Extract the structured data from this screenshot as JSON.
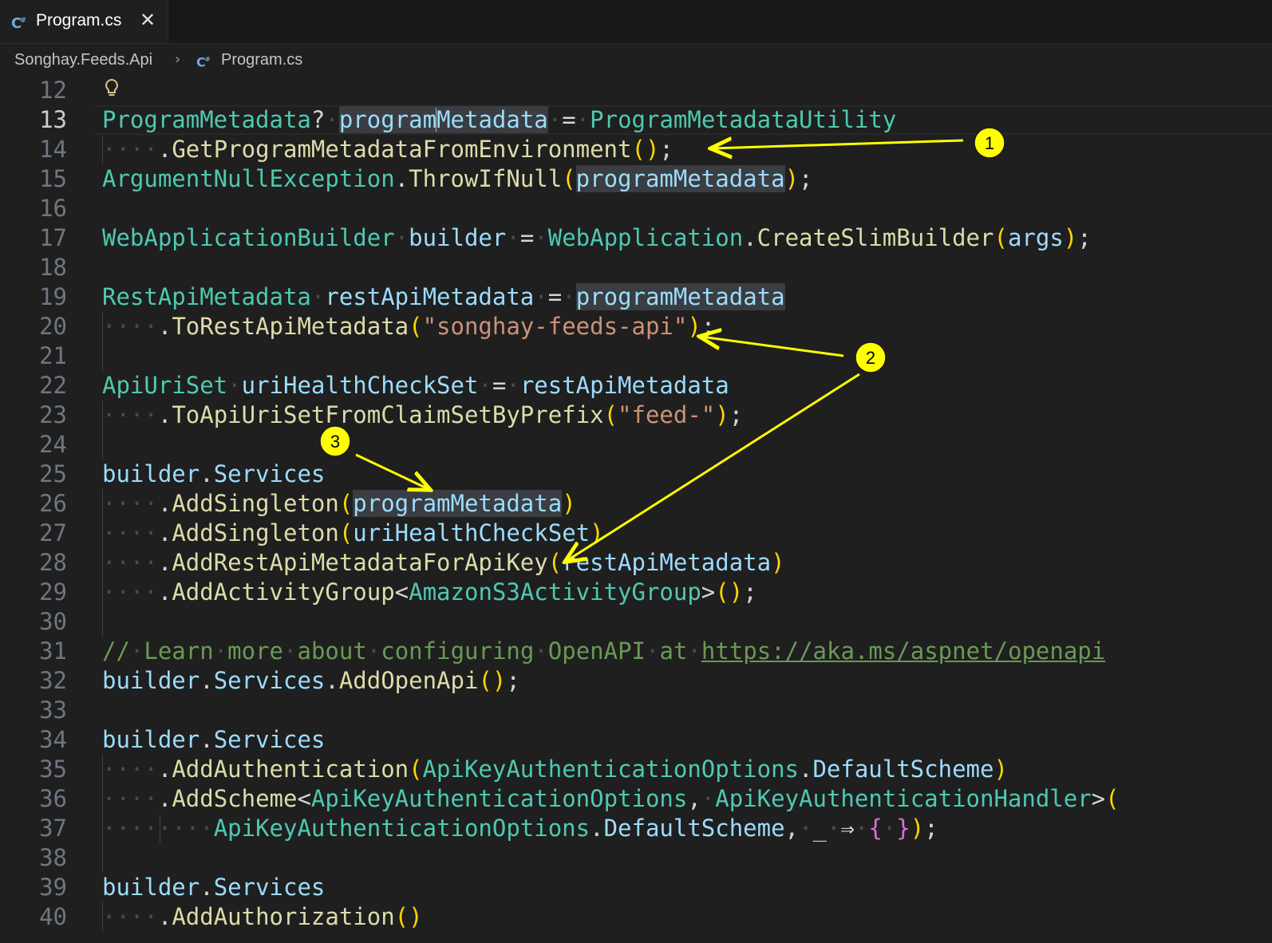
{
  "tab": {
    "label": "Program.cs",
    "icon": "csharp-file-icon",
    "close": "close-icon"
  },
  "breadcrumb": {
    "project": "Songhay.Feeds.Api",
    "file": "Program.cs"
  },
  "editor": {
    "active_line": 13,
    "lines": [
      {
        "n": "12"
      },
      {
        "n": "13"
      },
      {
        "n": "14"
      },
      {
        "n": "15"
      },
      {
        "n": "16"
      },
      {
        "n": "17"
      },
      {
        "n": "18"
      },
      {
        "n": "19"
      },
      {
        "n": "20"
      },
      {
        "n": "21"
      },
      {
        "n": "22"
      },
      {
        "n": "23"
      },
      {
        "n": "24"
      },
      {
        "n": "25"
      },
      {
        "n": "26"
      },
      {
        "n": "27"
      },
      {
        "n": "28"
      },
      {
        "n": "29"
      },
      {
        "n": "30"
      },
      {
        "n": "31"
      },
      {
        "n": "32"
      },
      {
        "n": "33"
      },
      {
        "n": "34"
      },
      {
        "n": "35"
      },
      {
        "n": "36"
      },
      {
        "n": "37"
      },
      {
        "n": "38"
      },
      {
        "n": "39"
      },
      {
        "n": "40"
      }
    ],
    "code": [
      [],
      [
        [
          "t",
          "ProgramMetadata"
        ],
        [
          "p",
          "?"
        ],
        [
          "ws",
          "·"
        ],
        [
          "v hl",
          "program"
        ],
        [
          "cursor",
          ""
        ],
        [
          "v hl",
          "Metadata"
        ],
        [
          "ws",
          "·"
        ],
        [
          "p",
          "="
        ],
        [
          "ws",
          "·"
        ],
        [
          "t",
          "ProgramMetadataUtility"
        ]
      ],
      [
        [
          "ws",
          "····"
        ],
        [
          "p",
          "."
        ],
        [
          "m",
          "GetProgramMetadataFromEnvironment"
        ],
        [
          "b1",
          "()"
        ],
        [
          "p",
          ";"
        ]
      ],
      [
        [
          "t",
          "ArgumentNullException"
        ],
        [
          "p",
          "."
        ],
        [
          "m",
          "ThrowIfNull"
        ],
        [
          "b1",
          "("
        ],
        [
          "v hl",
          "programMetadata"
        ],
        [
          "b1",
          ")"
        ],
        [
          "p",
          ";"
        ]
      ],
      [],
      [
        [
          "t",
          "WebApplicationBuilder"
        ],
        [
          "ws",
          "·"
        ],
        [
          "v",
          "builder"
        ],
        [
          "ws",
          "·"
        ],
        [
          "p",
          "="
        ],
        [
          "ws",
          "·"
        ],
        [
          "t",
          "WebApplication"
        ],
        [
          "p",
          "."
        ],
        [
          "m",
          "CreateSlimBuilder"
        ],
        [
          "b1",
          "("
        ],
        [
          "v",
          "args"
        ],
        [
          "b1",
          ")"
        ],
        [
          "p",
          ";"
        ]
      ],
      [],
      [
        [
          "t",
          "RestApiMetadata"
        ],
        [
          "ws",
          "·"
        ],
        [
          "v",
          "restApiMetadata"
        ],
        [
          "ws",
          "·"
        ],
        [
          "p",
          "="
        ],
        [
          "ws",
          "·"
        ],
        [
          "v hl",
          "programMetadata"
        ]
      ],
      [
        [
          "ws",
          "····"
        ],
        [
          "p",
          "."
        ],
        [
          "m",
          "ToRestApiMetadata"
        ],
        [
          "b1",
          "("
        ],
        [
          "s",
          "\"songhay-feeds-api\""
        ],
        [
          "b1",
          ")"
        ],
        [
          "p",
          ";"
        ]
      ],
      [],
      [
        [
          "t",
          "ApiUriSet"
        ],
        [
          "ws",
          "·"
        ],
        [
          "v",
          "uriHealthCheckSet"
        ],
        [
          "ws",
          "·"
        ],
        [
          "p",
          "="
        ],
        [
          "ws",
          "·"
        ],
        [
          "v",
          "restApiMetadata"
        ]
      ],
      [
        [
          "ws",
          "····"
        ],
        [
          "p",
          "."
        ],
        [
          "m",
          "ToApiUriSetFromClaimSetByPrefix"
        ],
        [
          "b1",
          "("
        ],
        [
          "s",
          "\"feed-\""
        ],
        [
          "b1",
          ")"
        ],
        [
          "p",
          ";"
        ]
      ],
      [],
      [
        [
          "v",
          "builder"
        ],
        [
          "p",
          "."
        ],
        [
          "v",
          "Services"
        ]
      ],
      [
        [
          "ws",
          "····"
        ],
        [
          "p",
          "."
        ],
        [
          "m",
          "AddSingleton"
        ],
        [
          "b1",
          "("
        ],
        [
          "v hl",
          "programMetadata"
        ],
        [
          "b1",
          ")"
        ]
      ],
      [
        [
          "ws",
          "····"
        ],
        [
          "p",
          "."
        ],
        [
          "m",
          "AddSingleton"
        ],
        [
          "b1",
          "("
        ],
        [
          "v",
          "uriHealthCheckSet"
        ],
        [
          "b1",
          ")"
        ]
      ],
      [
        [
          "ws",
          "····"
        ],
        [
          "p",
          "."
        ],
        [
          "m",
          "AddRestApiMetadataForApiKey"
        ],
        [
          "b1",
          "("
        ],
        [
          "v",
          "restApiMetadata"
        ],
        [
          "b1",
          ")"
        ]
      ],
      [
        [
          "ws",
          "····"
        ],
        [
          "p",
          "."
        ],
        [
          "m",
          "AddActivityGroup"
        ],
        [
          "p",
          "<"
        ],
        [
          "t",
          "AmazonS3ActivityGroup"
        ],
        [
          "p",
          ">"
        ],
        [
          "b1",
          "()"
        ],
        [
          "p",
          ";"
        ]
      ],
      [],
      [
        [
          "c",
          "//"
        ],
        [
          "ws",
          "·"
        ],
        [
          "c",
          "Learn"
        ],
        [
          "ws",
          "·"
        ],
        [
          "c",
          "more"
        ],
        [
          "ws",
          "·"
        ],
        [
          "c",
          "about"
        ],
        [
          "ws",
          "·"
        ],
        [
          "c",
          "configuring"
        ],
        [
          "ws",
          "·"
        ],
        [
          "c",
          "OpenAPI"
        ],
        [
          "ws",
          "·"
        ],
        [
          "c",
          "at"
        ],
        [
          "ws",
          "·"
        ],
        [
          "u",
          "https://aka.ms/aspnet/openapi"
        ]
      ],
      [
        [
          "v",
          "builder"
        ],
        [
          "p",
          "."
        ],
        [
          "v",
          "Services"
        ],
        [
          "p",
          "."
        ],
        [
          "m",
          "AddOpenApi"
        ],
        [
          "b1",
          "()"
        ],
        [
          "p",
          ";"
        ]
      ],
      [],
      [
        [
          "v",
          "builder"
        ],
        [
          "p",
          "."
        ],
        [
          "v",
          "Services"
        ]
      ],
      [
        [
          "ws",
          "····"
        ],
        [
          "p",
          "."
        ],
        [
          "m",
          "AddAuthentication"
        ],
        [
          "b1",
          "("
        ],
        [
          "t",
          "ApiKeyAuthenticationOptions"
        ],
        [
          "p",
          "."
        ],
        [
          "v",
          "DefaultScheme"
        ],
        [
          "b1",
          ")"
        ]
      ],
      [
        [
          "ws",
          "····"
        ],
        [
          "p",
          "."
        ],
        [
          "m",
          "AddScheme"
        ],
        [
          "p",
          "<"
        ],
        [
          "t",
          "ApiKeyAuthenticationOptions"
        ],
        [
          "p",
          ","
        ],
        [
          "ws",
          "·"
        ],
        [
          "t",
          "ApiKeyAuthenticationHandler"
        ],
        [
          "p",
          ">"
        ],
        [
          "b1",
          "("
        ]
      ],
      [
        [
          "ws",
          "········"
        ],
        [
          "t",
          "ApiKeyAuthenticationOptions"
        ],
        [
          "p",
          "."
        ],
        [
          "v",
          "DefaultScheme"
        ],
        [
          "p",
          ","
        ],
        [
          "ws",
          "·"
        ],
        [
          "v",
          "_"
        ],
        [
          "ws",
          "·"
        ],
        [
          "p",
          "⇒"
        ],
        [
          "ws",
          "·"
        ],
        [
          "b2",
          "{"
        ],
        [
          "ws",
          "·"
        ],
        [
          "b2",
          "}"
        ],
        [
          "b1",
          ")"
        ],
        [
          "p",
          ";"
        ]
      ],
      [],
      [
        [
          "v",
          "builder"
        ],
        [
          "p",
          "."
        ],
        [
          "v",
          "Services"
        ]
      ],
      [
        [
          "ws",
          "····"
        ],
        [
          "p",
          "."
        ],
        [
          "m",
          "AddAuthorization"
        ],
        [
          "b1",
          "()"
        ]
      ]
    ]
  },
  "annotations": {
    "callouts": [
      {
        "label": "1"
      },
      {
        "label": "2"
      },
      {
        "label": "3"
      }
    ],
    "color": "#ffff00"
  },
  "colors": {
    "type": "#4ec9b0",
    "variable": "#9cdcfe",
    "method": "#dcdcaa",
    "string": "#ce9178",
    "comment": "#6a9955",
    "bracket": "#ffd700",
    "brace": "#da70d6",
    "background": "#1f1f1f"
  }
}
